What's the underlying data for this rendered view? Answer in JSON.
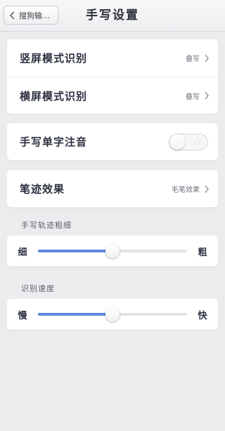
{
  "nav": {
    "back_label": "搜狗输…",
    "title": "手写设置"
  },
  "recognition": {
    "portrait_label": "竖屏模式识别",
    "portrait_value": "叠写",
    "landscape_label": "横屏模式识别",
    "landscape_value": "叠写"
  },
  "pinyin": {
    "label": "手写单字注音",
    "enabled": false
  },
  "stroke_effect": {
    "label": "笔迹效果",
    "value": "毛笔效果"
  },
  "thickness": {
    "section_label": "手写轨迹粗细",
    "min_label": "细",
    "max_label": "粗",
    "value_fraction": 0.5
  },
  "speed": {
    "section_label": "识别速度",
    "min_label": "慢",
    "max_label": "快",
    "value_fraction": 0.5
  },
  "colors": {
    "accent": "#5b8be0",
    "background": "#ececef",
    "card": "#ffffff"
  }
}
